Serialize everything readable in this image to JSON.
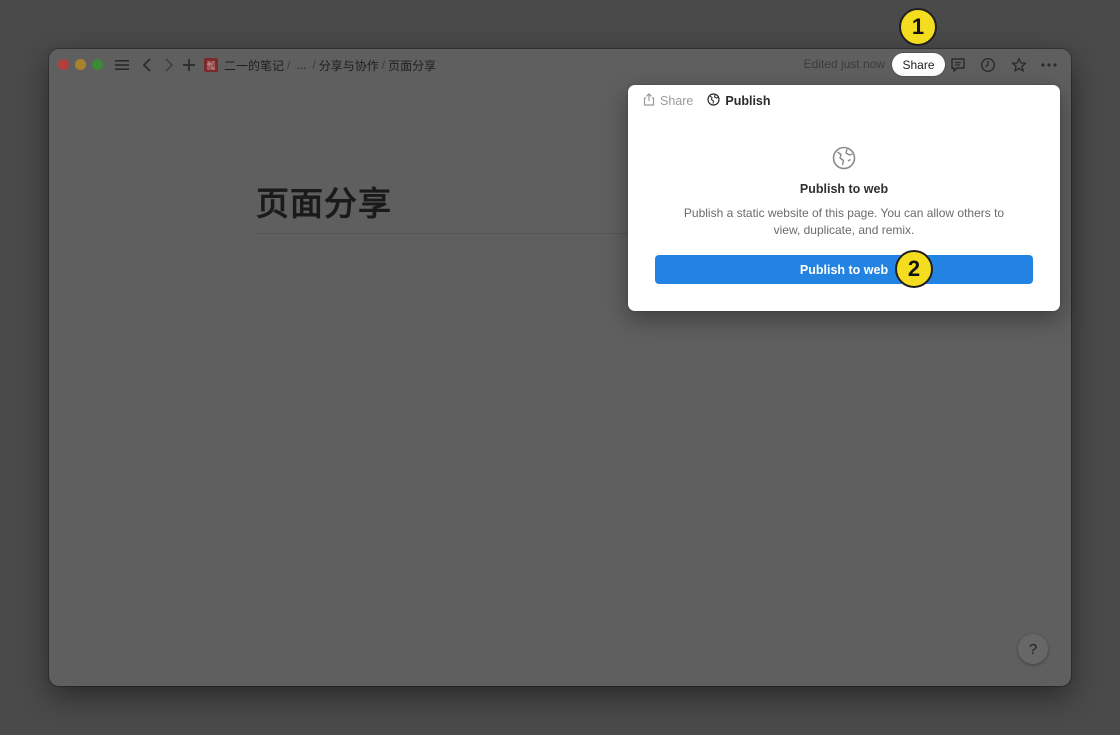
{
  "breadcrumb": {
    "workspace_icon_char": "瓢",
    "items": [
      "二一的笔记",
      "...",
      "分享与协作",
      "页面分享"
    ],
    "separator": "/"
  },
  "toolbar": {
    "edited_status": "Edited just now",
    "share_label": "Share",
    "icons": [
      "menu-icon",
      "back-icon",
      "forward-icon",
      "add-icon",
      "comment-icon",
      "history-icon",
      "star-icon",
      "more-icon"
    ]
  },
  "page": {
    "title": "页面分享"
  },
  "popover": {
    "tabs": [
      {
        "label": "Share",
        "icon": "share-icon",
        "active": false
      },
      {
        "label": "Publish",
        "icon": "globe-icon",
        "active": true
      }
    ],
    "heading": "Publish to web",
    "description": "Publish a static website of this page. You can allow others to view, duplicate, and remix.",
    "button_label": "Publish to web"
  },
  "help": {
    "label": "?"
  },
  "markers": [
    "1",
    "2"
  ],
  "colors": {
    "accent_blue": "#2383e2",
    "marker_yellow": "#f4dd1f"
  }
}
